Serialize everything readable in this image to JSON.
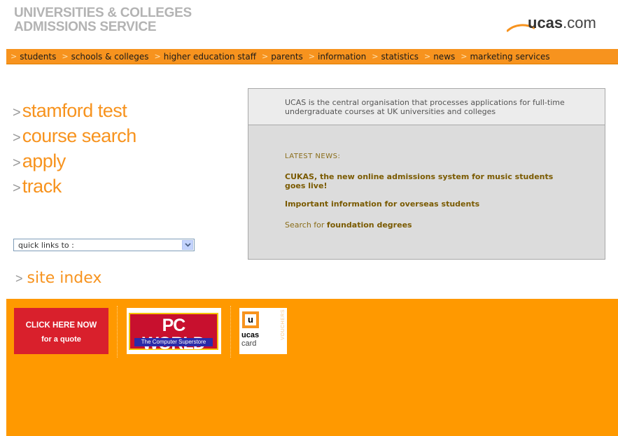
{
  "header": {
    "org_line1": "UNIVERSITIES & COLLEGES",
    "org_line2": "ADMISSIONS SERVICE",
    "logo_bold": "ucas",
    "logo_rest": ".com"
  },
  "nav": {
    "items": [
      "students",
      "schools & colleges",
      "higher education staff",
      "parents",
      "information",
      "statistics",
      "news",
      "marketing services"
    ]
  },
  "big_links": [
    "stamford test",
    "course search",
    "apply",
    "track"
  ],
  "arrow_glyph": ">",
  "quick_links": {
    "selected": "quick links to :"
  },
  "site_index": "site index",
  "info": {
    "intro": "UCAS is the central organisation that processes applications for full-time undergraduate courses at UK universities and colleges",
    "latest_heading": "LATEST NEWS:",
    "news1": "CUKAS, the new online admissions system for music students goes live!",
    "news2": "Important information for overseas students",
    "news3_prefix": "Search for",
    "news3_link": "foundation degrees"
  },
  "footer": {
    "quote_line1": "CLICK HERE NOW",
    "quote_line2": "for a quote",
    "pcworld_title": "PC WORLD",
    "pcworld_sub": "The Computer Superstore",
    "card_letter": "u",
    "card_ucas": "ucas",
    "card_card": "card",
    "card_vouchers": "VOUCHERS"
  },
  "colors": {
    "accent": "#f7931e",
    "footer_bg": "#ff9900",
    "quote_red": "#d9202c"
  },
  "icons": {
    "quick_links_button": "chevron-down-icon",
    "logo_swoosh": "swoosh-icon"
  }
}
